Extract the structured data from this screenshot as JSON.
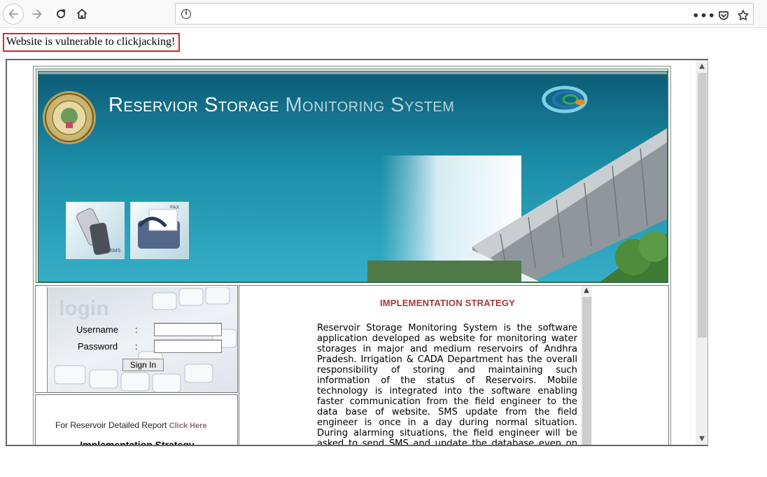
{
  "browser": {
    "url": "",
    "icons": [
      "back-icon",
      "forward-icon",
      "reload-icon",
      "home-icon",
      "info-icon",
      "more-icon",
      "pocket-icon",
      "bookmark-star-icon"
    ]
  },
  "warning": {
    "text": "Website is vulnerable to clickjacking!",
    "border_color": "#d9262c"
  },
  "banner": {
    "title_part1": "Reservior Storage",
    "title_part2": "Monitoring System",
    "sms_label": "SMS",
    "fax_label": "FAX"
  },
  "login": {
    "heading": "login",
    "username_label": "Username",
    "password_label": "Password",
    "colon": ":",
    "username_value": "",
    "password_value": "",
    "signin_label": "Sign In"
  },
  "report": {
    "text": "For Reservoir Detailed Report",
    "link": "Click Here",
    "subheading": "Implementation Strategy"
  },
  "content": {
    "title": "IMPLEMENTATION STRATEGY",
    "paragraph": "Reservoir Storage Monitoring System is the software application developed as website for monitoring water storages in major and medium reservoirs of Andhra Pradesh. Irrigation & CADA Department has the overall responsibility of storing and maintaining such information of the status of Reservoirs. Mobile technology is integrated into the software enabling faster communication from the field engineer to the data base of website. SMS update from the field engineer is once in a day during normal situation. During alarming situations, the field engineer will be asked to send SMS and update the database even on hourly basis. Most of the regular"
  },
  "colors": {
    "title_red": "#a2393a",
    "banner_teal": "#1d8ea9",
    "link": "#8a6d6d"
  }
}
